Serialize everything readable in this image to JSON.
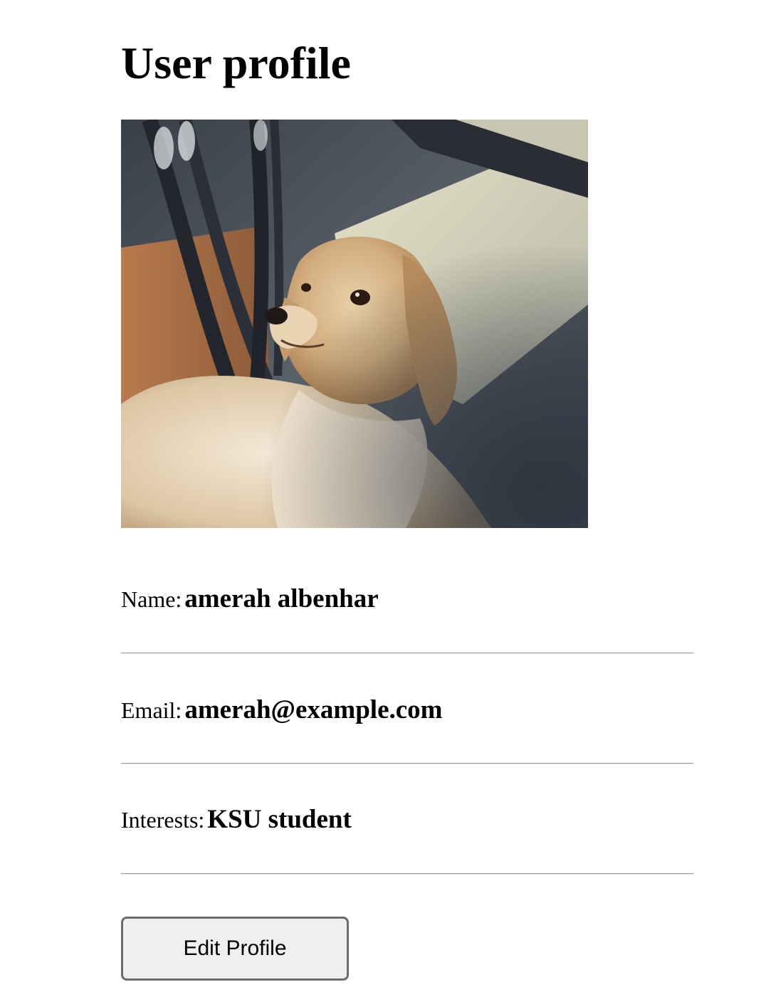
{
  "page": {
    "title": "User profile"
  },
  "profile": {
    "photo_icon": "dog-photo",
    "fields": [
      {
        "label": "Name:",
        "value": "amerah albenhar"
      },
      {
        "label": "Email:",
        "value": "amerah@example.com"
      },
      {
        "label": "Interests:",
        "value": "KSU student"
      }
    ]
  },
  "actions": {
    "edit_label": "Edit Profile"
  }
}
